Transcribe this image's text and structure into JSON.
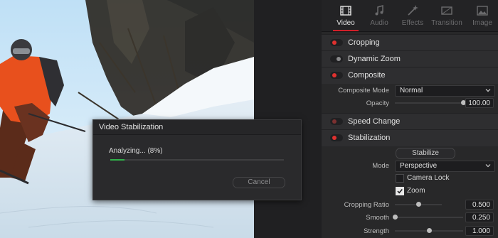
{
  "tabs": [
    {
      "label": "Video",
      "icon": "film-icon",
      "active": true
    },
    {
      "label": "Audio",
      "icon": "music-note-icon",
      "active": false
    },
    {
      "label": "Effects",
      "icon": "magic-wand-icon",
      "active": false
    },
    {
      "label": "Transition",
      "icon": "transition-icon",
      "active": false
    },
    {
      "label": "Image",
      "icon": "image-icon",
      "active": false
    }
  ],
  "sections": {
    "cropping": {
      "title": "Cropping",
      "enabled": true
    },
    "dynamic_zoom": {
      "title": "Dynamic Zoom",
      "enabled": false
    },
    "composite": {
      "title": "Composite",
      "enabled": true,
      "mode_label": "Composite Mode",
      "mode_value": "Normal",
      "opacity_label": "Opacity",
      "opacity_value": "100.00",
      "opacity_fraction": 1.0
    },
    "speed_change": {
      "title": "Speed Change",
      "enabled": false
    },
    "stabilization": {
      "title": "Stabilization",
      "enabled": true,
      "stabilize_label": "Stabilize",
      "mode_label": "Mode",
      "mode_value": "Perspective",
      "camera_lock_label": "Camera Lock",
      "camera_lock": false,
      "zoom_label": "Zoom",
      "zoom": true,
      "cropping_ratio_label": "Cropping Ratio",
      "cropping_ratio_value": "0.500",
      "cropping_ratio_fraction": 0.5,
      "smooth_label": "Smooth",
      "smooth_value": "0.250",
      "smooth_fraction": 0.0,
      "strength_label": "Strength",
      "strength_value": "1.000",
      "strength_fraction": 0.5
    }
  },
  "dialog": {
    "title": "Video Stabilization",
    "status": "Analyzing... (8%)",
    "progress": 0.08,
    "cancel_label": "Cancel"
  },
  "colors": {
    "accent_red": "#d0202a",
    "progress_green": "#30b24a",
    "panel_bg": "#282829"
  }
}
